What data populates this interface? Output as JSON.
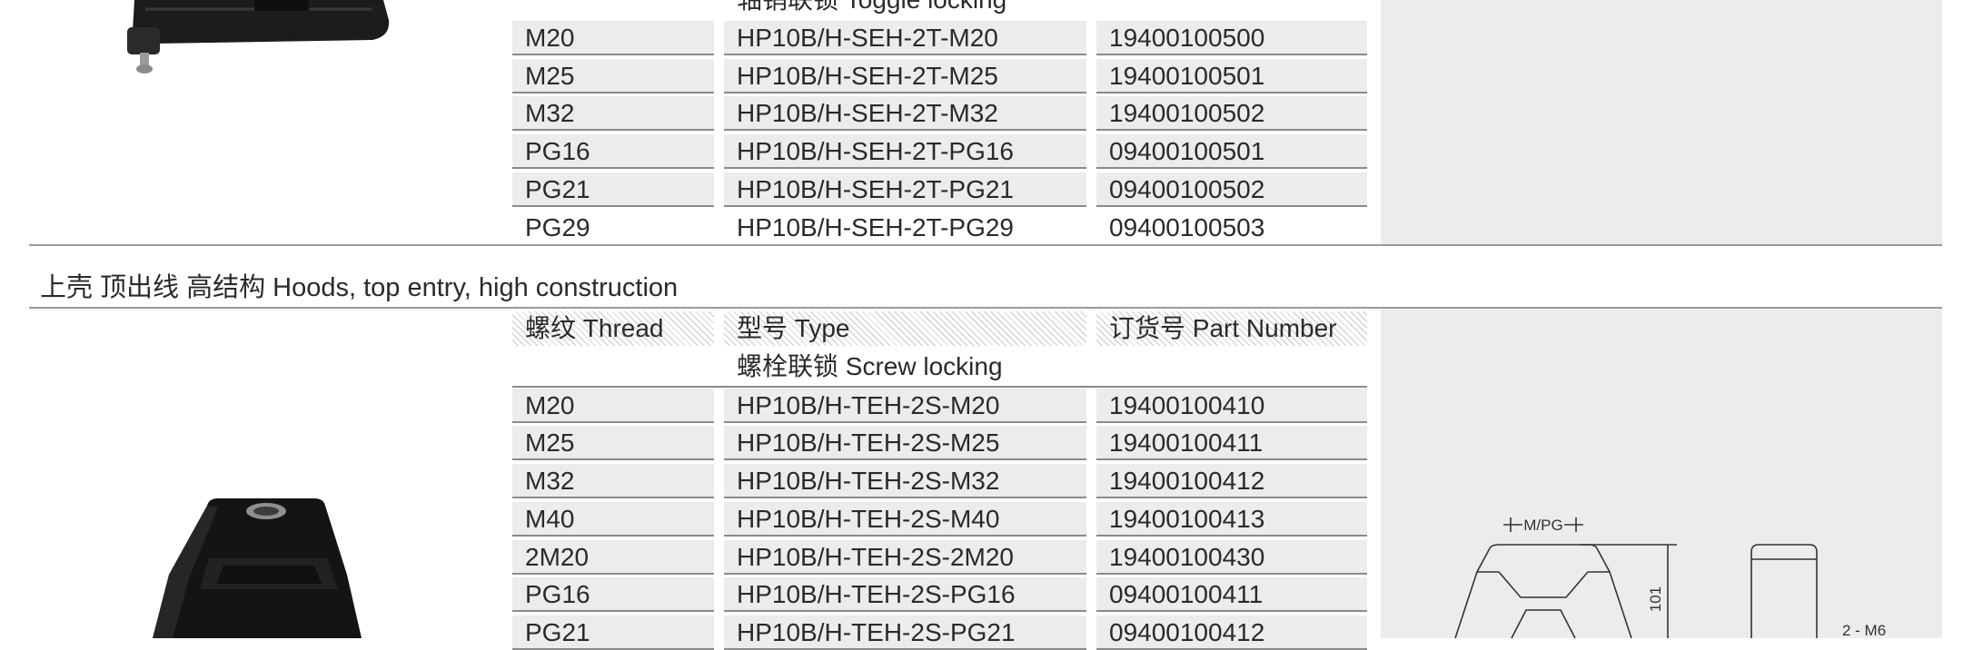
{
  "top_table": {
    "subheader_locking": "轴销联锁 Toggle locking",
    "rows": [
      {
        "thread": "M20",
        "type": "HP10B/H-SEH-2T-M20",
        "part": "19400100500"
      },
      {
        "thread": "M25",
        "type": "HP10B/H-SEH-2T-M25",
        "part": "19400100501"
      },
      {
        "thread": "M32",
        "type": "HP10B/H-SEH-2T-M32",
        "part": "19400100502"
      },
      {
        "thread": "PG16",
        "type": "HP10B/H-SEH-2T-PG16",
        "part": "09400100501"
      },
      {
        "thread": "PG21",
        "type": "HP10B/H-SEH-2T-PG21",
        "part": "09400100502"
      },
      {
        "thread": "PG29",
        "type": "HP10B/H-SEH-2T-PG29",
        "part": "09400100503"
      }
    ]
  },
  "section2": {
    "title": "上壳 顶出线 高结构 Hoods, top entry, high construction",
    "header": {
      "thread": "螺纹 Thread",
      "type": "型号 Type",
      "part": "订货号 Part Number"
    },
    "subheader_locking": "螺栓联锁 Screw locking",
    "rows": [
      {
        "thread": "M20",
        "type": "HP10B/H-TEH-2S-M20",
        "part": "19400100410"
      },
      {
        "thread": "M25",
        "type": "HP10B/H-TEH-2S-M25",
        "part": "19400100411"
      },
      {
        "thread": "M32",
        "type": "HP10B/H-TEH-2S-M32",
        "part": "19400100412"
      },
      {
        "thread": "M40",
        "type": "HP10B/H-TEH-2S-M40",
        "part": "19400100413"
      },
      {
        "thread": "2M20",
        "type": "HP10B/H-TEH-2S-2M20",
        "part": "19400100430"
      },
      {
        "thread": "PG16",
        "type": "HP10B/H-TEH-2S-PG16",
        "part": "09400100411"
      },
      {
        "thread": "PG21",
        "type": "HP10B/H-TEH-2S-PG21",
        "part": "09400100412"
      }
    ],
    "drawing_labels": {
      "thread_dim": "M/PG",
      "height_dim": "101",
      "screw_label": "2 - M6"
    }
  }
}
